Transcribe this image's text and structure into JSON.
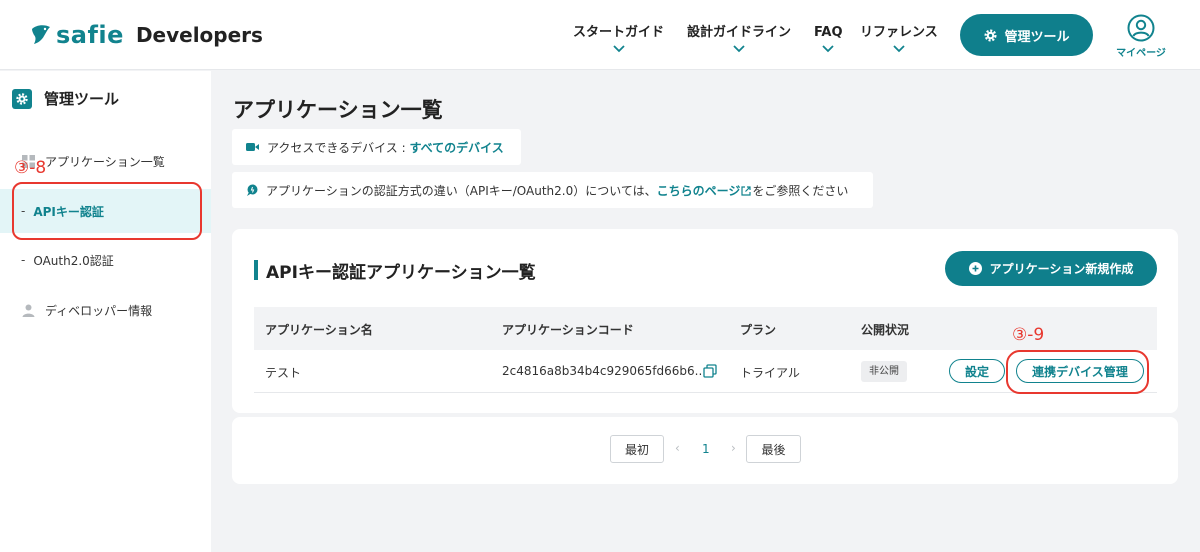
{
  "header": {
    "logo_brand": "safie",
    "logo_product": "Developers",
    "nav": [
      {
        "label": "スタートガイド"
      },
      {
        "label": "設計ガイドライン"
      },
      {
        "label": "FAQ"
      },
      {
        "label": "リファレンス"
      }
    ],
    "tool_button_label": "管理ツール",
    "mypage_label": "マイページ"
  },
  "sidebar": {
    "title": "管理ツール",
    "items": [
      {
        "label": "アプリケーション一覧",
        "icon": "grid-icon"
      },
      {
        "label": "APIキー認証",
        "prefix": "-",
        "active": true
      },
      {
        "label": "OAuth2.0認証",
        "prefix": "-"
      },
      {
        "label": "ディベロッパー情報",
        "icon": "person-icon"
      }
    ]
  },
  "annotations": {
    "a1": "③-8",
    "a2": "③-9"
  },
  "main": {
    "page_title": "アプリケーション一覧",
    "device_info": {
      "text": "アクセスできるデバイス : ",
      "link": "すべてのデバイス"
    },
    "auth_info": {
      "text_before": "アプリケーションの認証方式の違い（APIキー/OAuth2.0）については、",
      "link": "こちらのページ",
      "text_after": "をご参照ください"
    },
    "card": {
      "title": "APIキー認証アプリケーション一覧",
      "new_button_label": "アプリケーション新規作成",
      "columns": [
        "アプリケーション名",
        "アプリケーションコード",
        "プラン",
        "公開状況"
      ],
      "rows": [
        {
          "name": "テスト",
          "code": "2c4816a8b34b4c929065fd66b6...",
          "plan": "トライアル",
          "status": "非公開",
          "settings_label": "設定",
          "device_label": "連携デバイス管理"
        }
      ]
    },
    "pagination": {
      "first": "最初",
      "prev": "‹",
      "current": "1",
      "next": "›",
      "last": "最後"
    }
  },
  "colors": {
    "accent": "#0f7f8c",
    "active_bg": "#e3f5f7",
    "annotation": "#e8382f"
  }
}
